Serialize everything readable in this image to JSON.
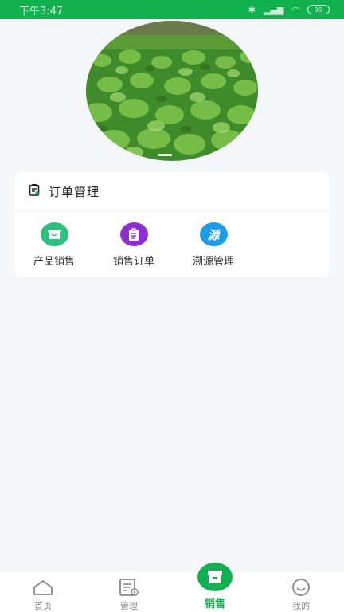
{
  "status_bar": {
    "time": "下午3:47",
    "battery": "99"
  },
  "banner": {
    "image": "vegetable-field-photo"
  },
  "order_card": {
    "title": "订单管理",
    "items": [
      {
        "label": "产品销售",
        "icon": "product-sales-icon",
        "color": "#2dbf7e"
      },
      {
        "label": "销售订单",
        "icon": "sales-order-icon",
        "color": "#8e2fd4"
      },
      {
        "label": "溯源管理",
        "icon": "traceability-icon",
        "color": "#1e9be6",
        "glyph": "源"
      }
    ]
  },
  "tabbar": {
    "tabs": [
      {
        "label": "首页",
        "icon": "home-icon"
      },
      {
        "label": "管理",
        "icon": "manage-icon"
      },
      {
        "label": "销售",
        "icon": "sales-icon",
        "active": true
      },
      {
        "label": "我的",
        "icon": "profile-icon"
      }
    ],
    "active_color": "#12b14f"
  }
}
